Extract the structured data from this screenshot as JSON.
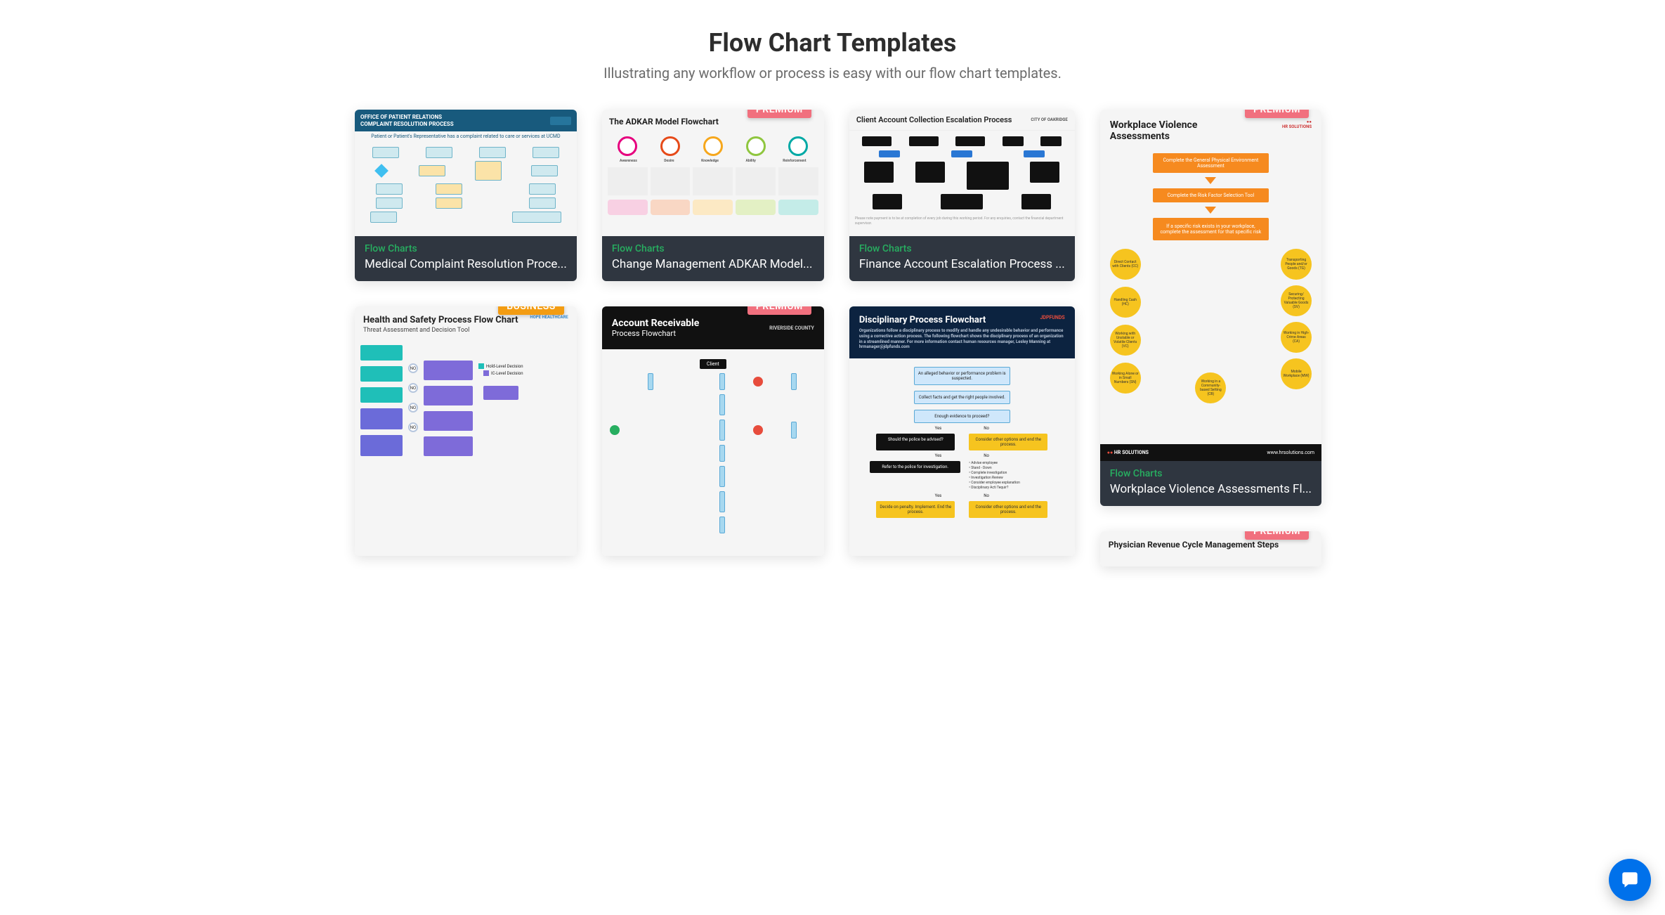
{
  "header": {
    "title": "Flow Chart Templates",
    "subtitle": "Illustrating any workflow or process is easy with our flow chart templates."
  },
  "badges": {
    "premium": "PREMIUM",
    "business": "BUSINESS"
  },
  "cards": {
    "medical": {
      "category": "Flow Charts",
      "title": "Medical Complaint Resolution Proce...",
      "thumb_header": "OFFICE OF PATIENT RELATIONS\nCOMPLAINT RESOLUTION PROCESS",
      "thumb_subhead": "Patient or Patient's Representative has a complaint related to care or services at UCMD"
    },
    "adkar": {
      "category": "Flow Charts",
      "title": "Change Management ADKAR Model...",
      "thumb_title": "The ADKAR Model Flowchart",
      "labels": [
        "Awareness",
        "Desire",
        "Knowledge",
        "Ability",
        "Reinforcement"
      ]
    },
    "finance": {
      "category": "Flow Charts",
      "title": "Finance Account Escalation Process ...",
      "thumb_title": "Client Account Collection Escalation Process",
      "brand": "CITY OF OAKRIDGE"
    },
    "violence": {
      "category": "Flow Charts",
      "title": "Workplace Violence Assessments Fl...",
      "thumb_title": "Workplace Violence Assessments",
      "brand": "HR SOLUTIONS",
      "steps": [
        "Complete the General Physical Environment Assessment",
        "Complete the Risk Factor Selection Tool",
        "If a specific risk exists in your workplace, complete the assessment for that specific risk"
      ],
      "risk_nodes_left": [
        "Direct Contact with Clients (CC)",
        "Handling Cash (HC)",
        "Working with Unstable or Volatile Clients (VC)",
        "Working Alone or in Small Numbers (SN)"
      ],
      "risk_nodes_right": [
        "Transporting People and/or Goods (TG)",
        "Securing/ Protecting Valuable Goods (SV)",
        "Working in High-Crime Areas (CA)",
        "Mobile Workplace (MW)",
        "Working in a Community-based Setting (CB)"
      ],
      "footer_brand": "HR SOLUTIONS",
      "footer_url": "www.hrsolutions.com"
    },
    "health": {
      "thumb_title": "Health and Safety Process Flow Chart",
      "thumb_sub": "Threat Assessment and Decision Tool",
      "brand": "HOPE HEALTHCARE",
      "legend": [
        "Hold-Level Decision",
        "IC-Level Decision"
      ]
    },
    "ar": {
      "thumb_title": "Account Receivable",
      "thumb_sub": "Process Flowchart",
      "brand": "RIVERSIDE COUNTY",
      "client": "Client"
    },
    "disciplinary": {
      "thumb_title": "Disciplinary Process Flowchart",
      "brand": "JDPFUNDS",
      "thumb_desc": "Organizations follow a disciplinary process to modify and handle any undesirable behavior and performance using a corrective action process. The following flowchart shows the disciplinary process of an organization in a streamlined manner. For more information contact human resources manager, Lesley Manning at hrmanager@jdpfunds.com",
      "yes": "Yes",
      "no": "No"
    },
    "physician": {
      "thumb_title": "Physician Revenue Cycle Management Steps"
    }
  },
  "chat": {
    "label": "Open chat"
  }
}
